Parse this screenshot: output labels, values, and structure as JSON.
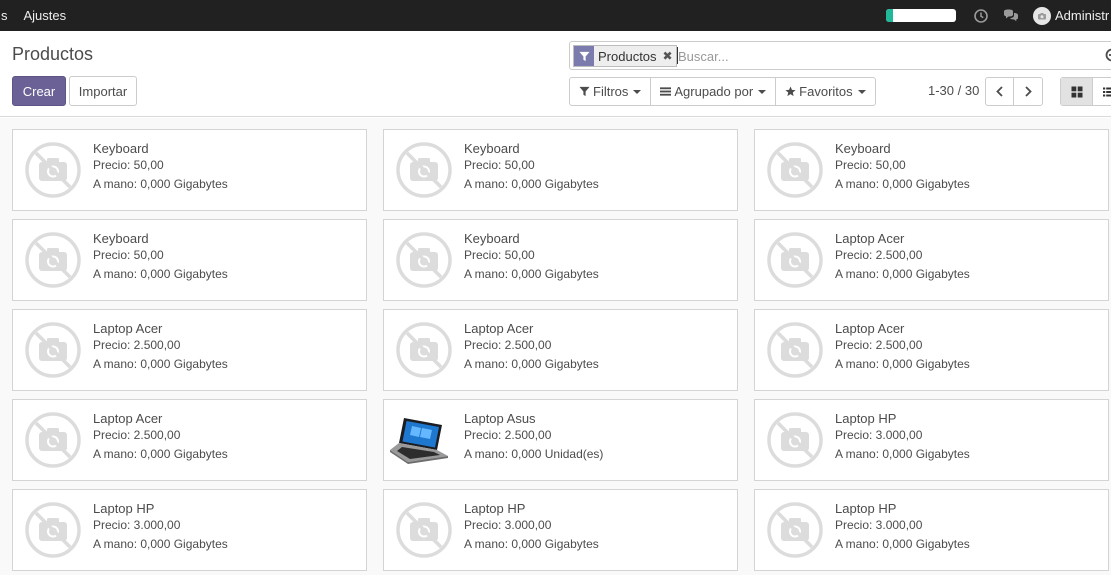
{
  "navbar": {
    "menu_fragment": "s",
    "settings_label": "Ajustes",
    "progress_fraction": 0.1,
    "user_label": "Administr"
  },
  "control_panel": {
    "title": "Productos",
    "create_label": "Crear",
    "import_label": "Importar",
    "search": {
      "facet_label": "Productos",
      "placeholder": "Buscar..."
    },
    "filters_label": "Filtros",
    "group_by_label": "Agrupado por",
    "favorites_label": "Favoritos",
    "pager_text": "1-30 / 30"
  },
  "products": [
    {
      "name": "Keyboard",
      "price": "Precio: 50,00",
      "on_hand": "A mano: 0,000 Gigabytes",
      "image": "no-image-icon"
    },
    {
      "name": "Keyboard",
      "price": "Precio: 50,00",
      "on_hand": "A mano: 0,000 Gigabytes",
      "image": "no-image-icon"
    },
    {
      "name": "Keyboard",
      "price": "Precio: 50,00",
      "on_hand": "A mano: 0,000 Gigabytes",
      "image": "no-image-icon"
    },
    {
      "name": "Keyboard",
      "price": "Precio: 50,00",
      "on_hand": "A mano: 0,000 Gigabytes",
      "image": "no-image-icon"
    },
    {
      "name": "Keyboard",
      "price": "Precio: 50,00",
      "on_hand": "A mano: 0,000 Gigabytes",
      "image": "no-image-icon"
    },
    {
      "name": "Laptop Acer",
      "price": "Precio: 2.500,00",
      "on_hand": "A mano: 0,000 Gigabytes",
      "image": "no-image-icon"
    },
    {
      "name": "Laptop Acer",
      "price": "Precio: 2.500,00",
      "on_hand": "A mano: 0,000 Gigabytes",
      "image": "no-image-icon"
    },
    {
      "name": "Laptop Acer",
      "price": "Precio: 2.500,00",
      "on_hand": "A mano: 0,000 Gigabytes",
      "image": "no-image-icon"
    },
    {
      "name": "Laptop Acer",
      "price": "Precio: 2.500,00",
      "on_hand": "A mano: 0,000 Gigabytes",
      "image": "no-image-icon"
    },
    {
      "name": "Laptop Acer",
      "price": "Precio: 2.500,00",
      "on_hand": "A mano: 0,000 Gigabytes",
      "image": "no-image-icon"
    },
    {
      "name": "Laptop Asus",
      "price": "Precio: 2.500,00",
      "on_hand": "A mano: 0,000 Unidad(es)",
      "image": "laptop-image"
    },
    {
      "name": "Laptop HP",
      "price": "Precio: 3.000,00",
      "on_hand": "A mano: 0,000 Gigabytes",
      "image": "no-image-icon"
    },
    {
      "name": "Laptop HP",
      "price": "Precio: 3.000,00",
      "on_hand": "A mano: 0,000 Gigabytes",
      "image": "no-image-icon"
    },
    {
      "name": "Laptop HP",
      "price": "Precio: 3.000,00",
      "on_hand": "A mano: 0,000 Gigabytes",
      "image": "no-image-icon"
    },
    {
      "name": "Laptop HP",
      "price": "Precio: 3.000,00",
      "on_hand": "A mano: 0,000 Gigabytes",
      "image": "no-image-icon"
    }
  ],
  "colors": {
    "navbar": "#212121",
    "primary": "#6b6196",
    "facet": "#7c7bad",
    "progress": "#21b799"
  }
}
